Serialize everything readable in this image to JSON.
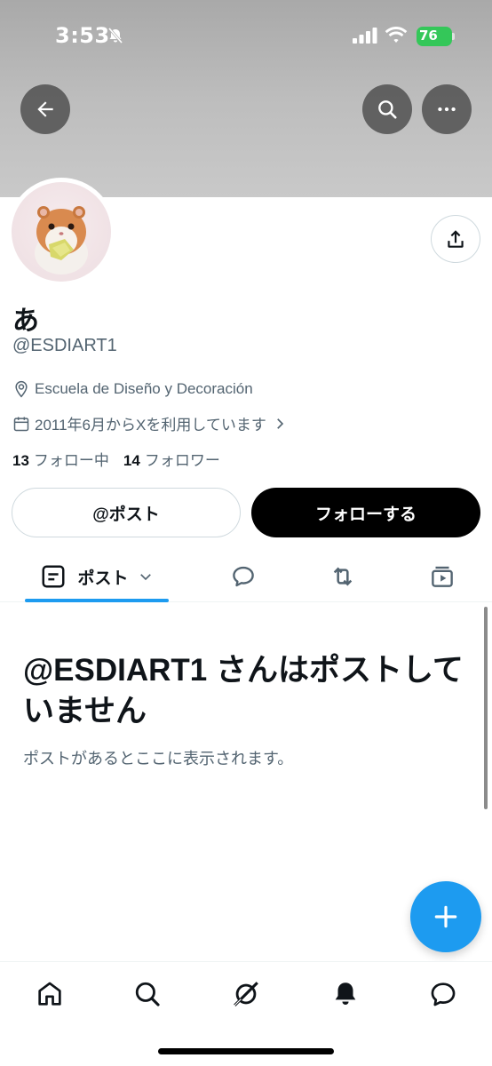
{
  "status_bar": {
    "time": "3:53",
    "battery": "76"
  },
  "header_actions": {
    "back_icon": "arrow-left-icon",
    "search_icon": "search-icon",
    "more_icon": "more-dots-icon"
  },
  "profile": {
    "display_name": "あ",
    "handle": "@ESDIART1",
    "location": "Escuela de Diseño y Decoración",
    "joined": "2011年6月からXを利用しています",
    "following_count": "13",
    "following_label": "フォロー中",
    "followers_count": "14",
    "followers_label": "フォロワー"
  },
  "actions": {
    "mention_label": "@ポスト",
    "follow_label": "フォローする"
  },
  "tabs": {
    "posts_label": "ポスト"
  },
  "empty_state": {
    "title": "@ESDIART1 さんはポストしていません",
    "subtitle": "ポストがあるとここに表示されます。"
  },
  "colors": {
    "accent": "#1d9bf0",
    "text_primary": "#0f1419",
    "text_secondary": "#536471",
    "battery": "#34c759"
  }
}
